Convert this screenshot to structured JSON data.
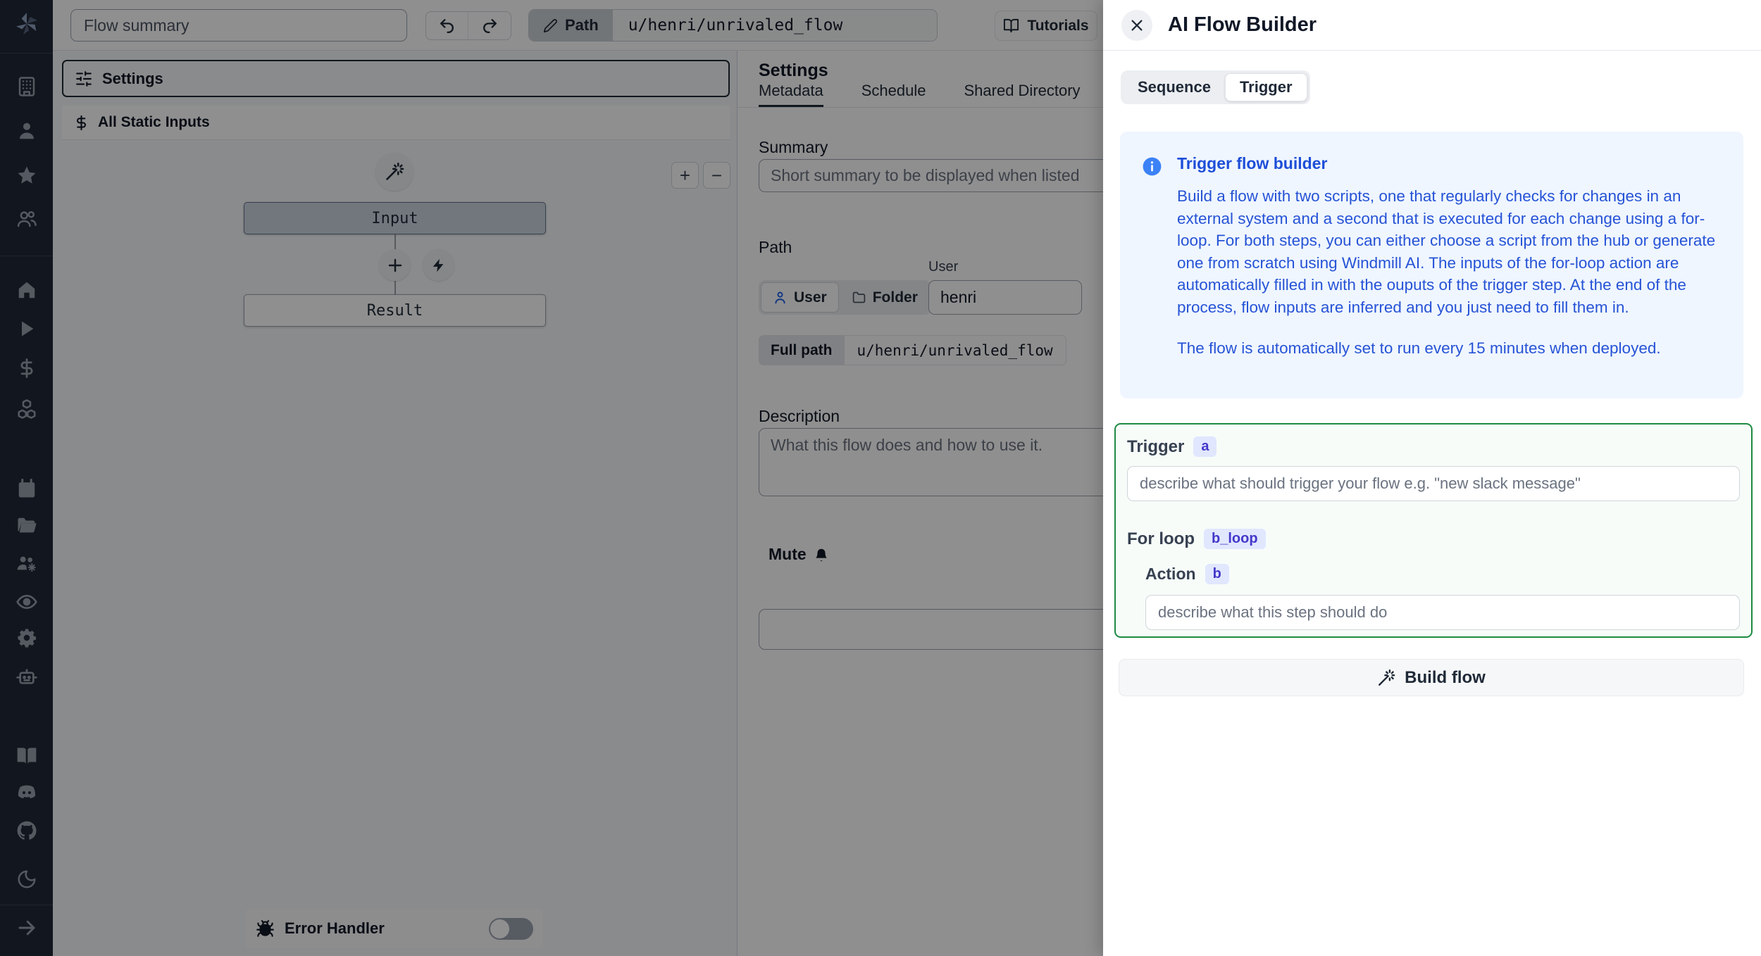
{
  "topbar": {
    "flow_summary_placeholder": "Flow summary",
    "path_label": "Path",
    "path_value": "u/henri/unrivaled_flow",
    "tutorials_label": "Tutorials"
  },
  "sidebar": {
    "icons": [
      "windmill-logo",
      "building",
      "user",
      "star",
      "users",
      "home",
      "play",
      "dollar-sign",
      "boxes",
      "calendar",
      "folder-open",
      "users-gear",
      "eye",
      "gear",
      "bot",
      "book-open",
      "discord",
      "github",
      "moon",
      "arrow-right"
    ]
  },
  "flow_panel": {
    "settings_button": "Settings",
    "static_inputs_button": "All Static Inputs",
    "input_node": "Input",
    "result_node": "Result",
    "zoom_in": "+",
    "zoom_out": "−",
    "error_handler_label": "Error Handler"
  },
  "settings_panel": {
    "title": "Settings",
    "tabs": [
      "Metadata",
      "Schedule",
      "Shared Directory"
    ],
    "summary_label": "Summary",
    "summary_placeholder": "Short summary to be displayed when listed",
    "path_label": "Path",
    "user_label": "User",
    "owner_user": "User",
    "owner_folder": "Folder",
    "user_value": "henri",
    "full_path_label": "Full path",
    "full_path_value": "u/henri/unrivaled_flow",
    "description_label": "Description",
    "description_placeholder": "What this flow does and how to use it.",
    "mute_label": "Mute"
  },
  "ai_panel": {
    "title": "AI Flow Builder",
    "tabs": [
      "Sequence",
      "Trigger"
    ],
    "active_tab": "Trigger",
    "info": {
      "title": "Trigger flow builder",
      "body": "Build a flow with two scripts, one that regularly checks for changes in an external system and a second that is executed for each change using a for-loop. For both steps, you can either choose a script from the hub or generate one from scratch using Windmill AI. The inputs of the for-loop action are automatically filled in with the ouputs of the trigger step. At the end of the process, flow inputs are inferred and you just need to fill them in.",
      "footer": "The flow is automatically set to run every 15 minutes when deployed."
    },
    "trigger_label": "Trigger",
    "trigger_badge": "a",
    "trigger_placeholder": "describe what should trigger your flow e.g. \"new slack message\"",
    "forloop_label": "For loop",
    "forloop_badge": "b_loop",
    "action_label": "Action",
    "action_badge": "b",
    "action_placeholder": "describe what this step should do",
    "build_button": "Build flow"
  },
  "colors": {
    "accent_blue": "#2563eb",
    "info_bg": "#eff6ff",
    "info_text": "#1d4ed8",
    "trigger_border": "#1d8a42",
    "badge_bg": "#e0e7ff",
    "badge_text": "#4338ca",
    "sidebar_bg": "#212836"
  }
}
